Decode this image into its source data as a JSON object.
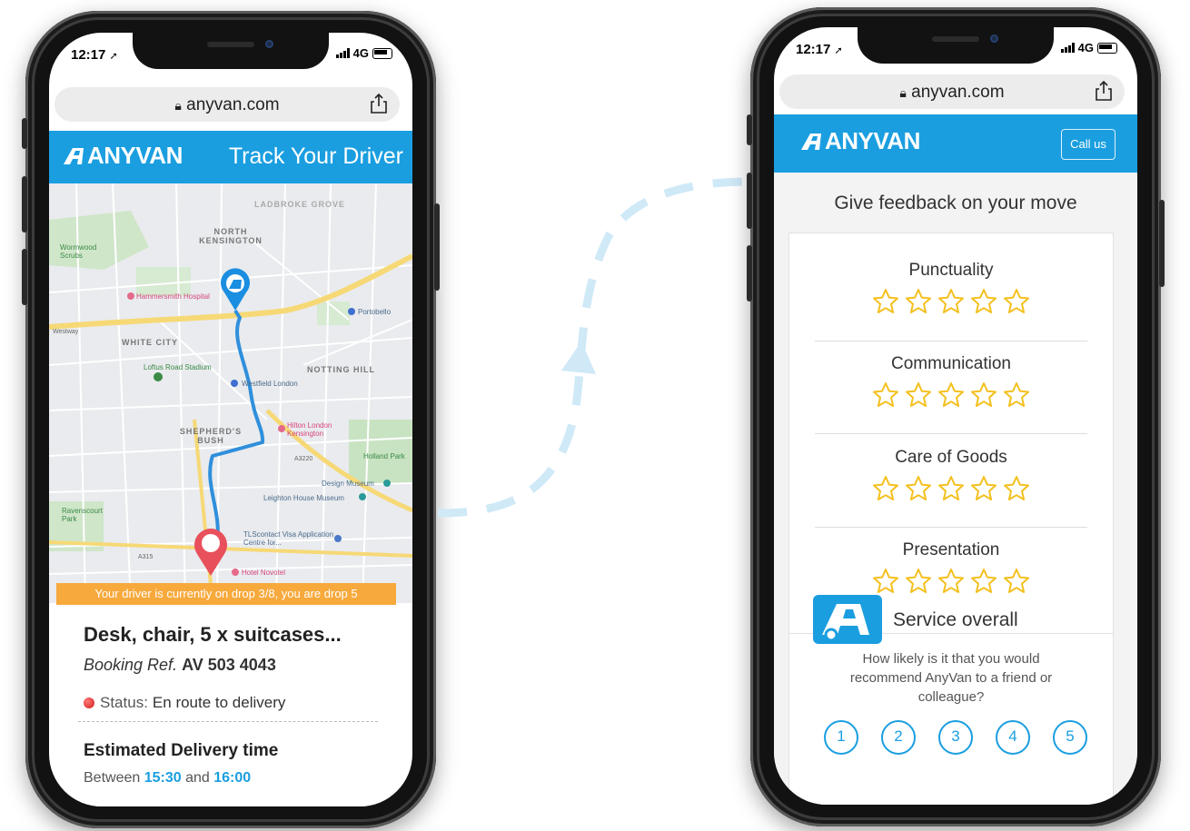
{
  "colors": {
    "brand_blue": "#1a9ee0",
    "banner_orange": "#f7a93c",
    "star_yellow": "#f4c01e",
    "route_blue": "#2f8fdc",
    "pin_red": "#e8505b",
    "arrow_blue": "#cfe9f7"
  },
  "left_phone": {
    "status_time": "12:17",
    "network": "4G",
    "url": "anyvan.com",
    "logo": "ANYVAN",
    "header_title": "Track Your Driver",
    "map": {
      "areas": [
        "LADBROKE GROVE",
        "NORTH KENSINGTON",
        "WHITE CITY",
        "NOTTING HILL",
        "SHEPHERD'S BUSH"
      ],
      "places": {
        "wormwood": "Wormwood Scrubs",
        "hammersmith": "Hammersmith Hospital",
        "portobello": "Portobello",
        "loftus": "Loftus Road Stadium",
        "westfield": "Westfield London",
        "hilton": "Hilton London Kensington",
        "holland": "Holland Park",
        "design": "Design Museum",
        "leighton": "Leighton House Museum",
        "ravenscourt": "Ravenscourt Park",
        "tlscontact": "TLScontact Visa Application Centre for...",
        "novotel": "Hotel Novotel"
      },
      "roads": {
        "westway": "Westway",
        "a315": "A315",
        "a3220": "A3220"
      }
    },
    "banner": "Your driver is currently on drop 3/8, you are drop 5",
    "item_title": "Desk, chair, 5 x suitcases...",
    "booking_label": "Booking Ref.",
    "booking_ref": "AV 503 4043",
    "status_label": "Status:",
    "status_value": "En route to delivery",
    "eta_title": "Estimated Delivery time",
    "eta_between": "Between",
    "eta_and": "and",
    "eta_from": "15:30",
    "eta_to": "16:00"
  },
  "right_phone": {
    "status_time": "12:17",
    "network": "4G",
    "url": "anyvan.com",
    "logo": "ANYVAN",
    "call_button": "Call us",
    "feedback_title": "Give feedback on your move",
    "ratings": [
      {
        "label": "Punctuality",
        "stars": 5
      },
      {
        "label": "Communication",
        "stars": 5
      },
      {
        "label": "Care of Goods",
        "stars": 5
      },
      {
        "label": "Presentation",
        "stars": 5
      }
    ],
    "service_title": "Service overall",
    "service_question": "How likely is it that you would recommend AnyVan to a friend or colleague?",
    "nps_options": [
      "1",
      "2",
      "3",
      "4",
      "5"
    ]
  }
}
